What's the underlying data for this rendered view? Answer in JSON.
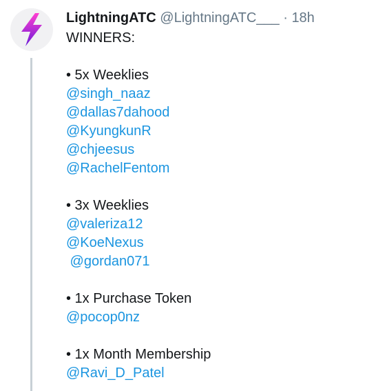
{
  "tweet": {
    "author_name": "LightningATC",
    "author_handle": "@LightningATC___",
    "separator": "·",
    "timestamp": "18h",
    "avatar_icon": "lightning-bolt-icon",
    "colors": {
      "mention": "#1b95e0",
      "bolt_top": "#ff3fd0",
      "bolt_bottom": "#6a1bd8"
    },
    "lines": [
      {
        "text": "WINNERS:",
        "type": "text"
      },
      {
        "text": "",
        "type": "blank"
      },
      {
        "text": "• 5x Weeklies",
        "type": "text"
      },
      {
        "text": "@singh_naaz",
        "type": "mention"
      },
      {
        "text": "@dallas7dahood",
        "type": "mention"
      },
      {
        "text": "@KyungkunR",
        "type": "mention"
      },
      {
        "text": "@chjeesus",
        "type": "mention"
      },
      {
        "text": "@RachelFentom",
        "type": "mention"
      },
      {
        "text": "",
        "type": "blank"
      },
      {
        "text": "• 3x Weeklies",
        "type": "text"
      },
      {
        "text": "@valeriza12",
        "type": "mention"
      },
      {
        "text": "@KoeNexus",
        "type": "mention"
      },
      {
        "text": " @gordan071",
        "type": "mention"
      },
      {
        "text": "",
        "type": "blank"
      },
      {
        "text": "• 1x Purchase Token",
        "type": "text"
      },
      {
        "text": "@pocop0nz",
        "type": "mention"
      },
      {
        "text": "",
        "type": "blank"
      },
      {
        "text": "• 1x Month Membership",
        "type": "text"
      },
      {
        "text": "@Ravi_D_Patel",
        "type": "mention"
      }
    ]
  }
}
